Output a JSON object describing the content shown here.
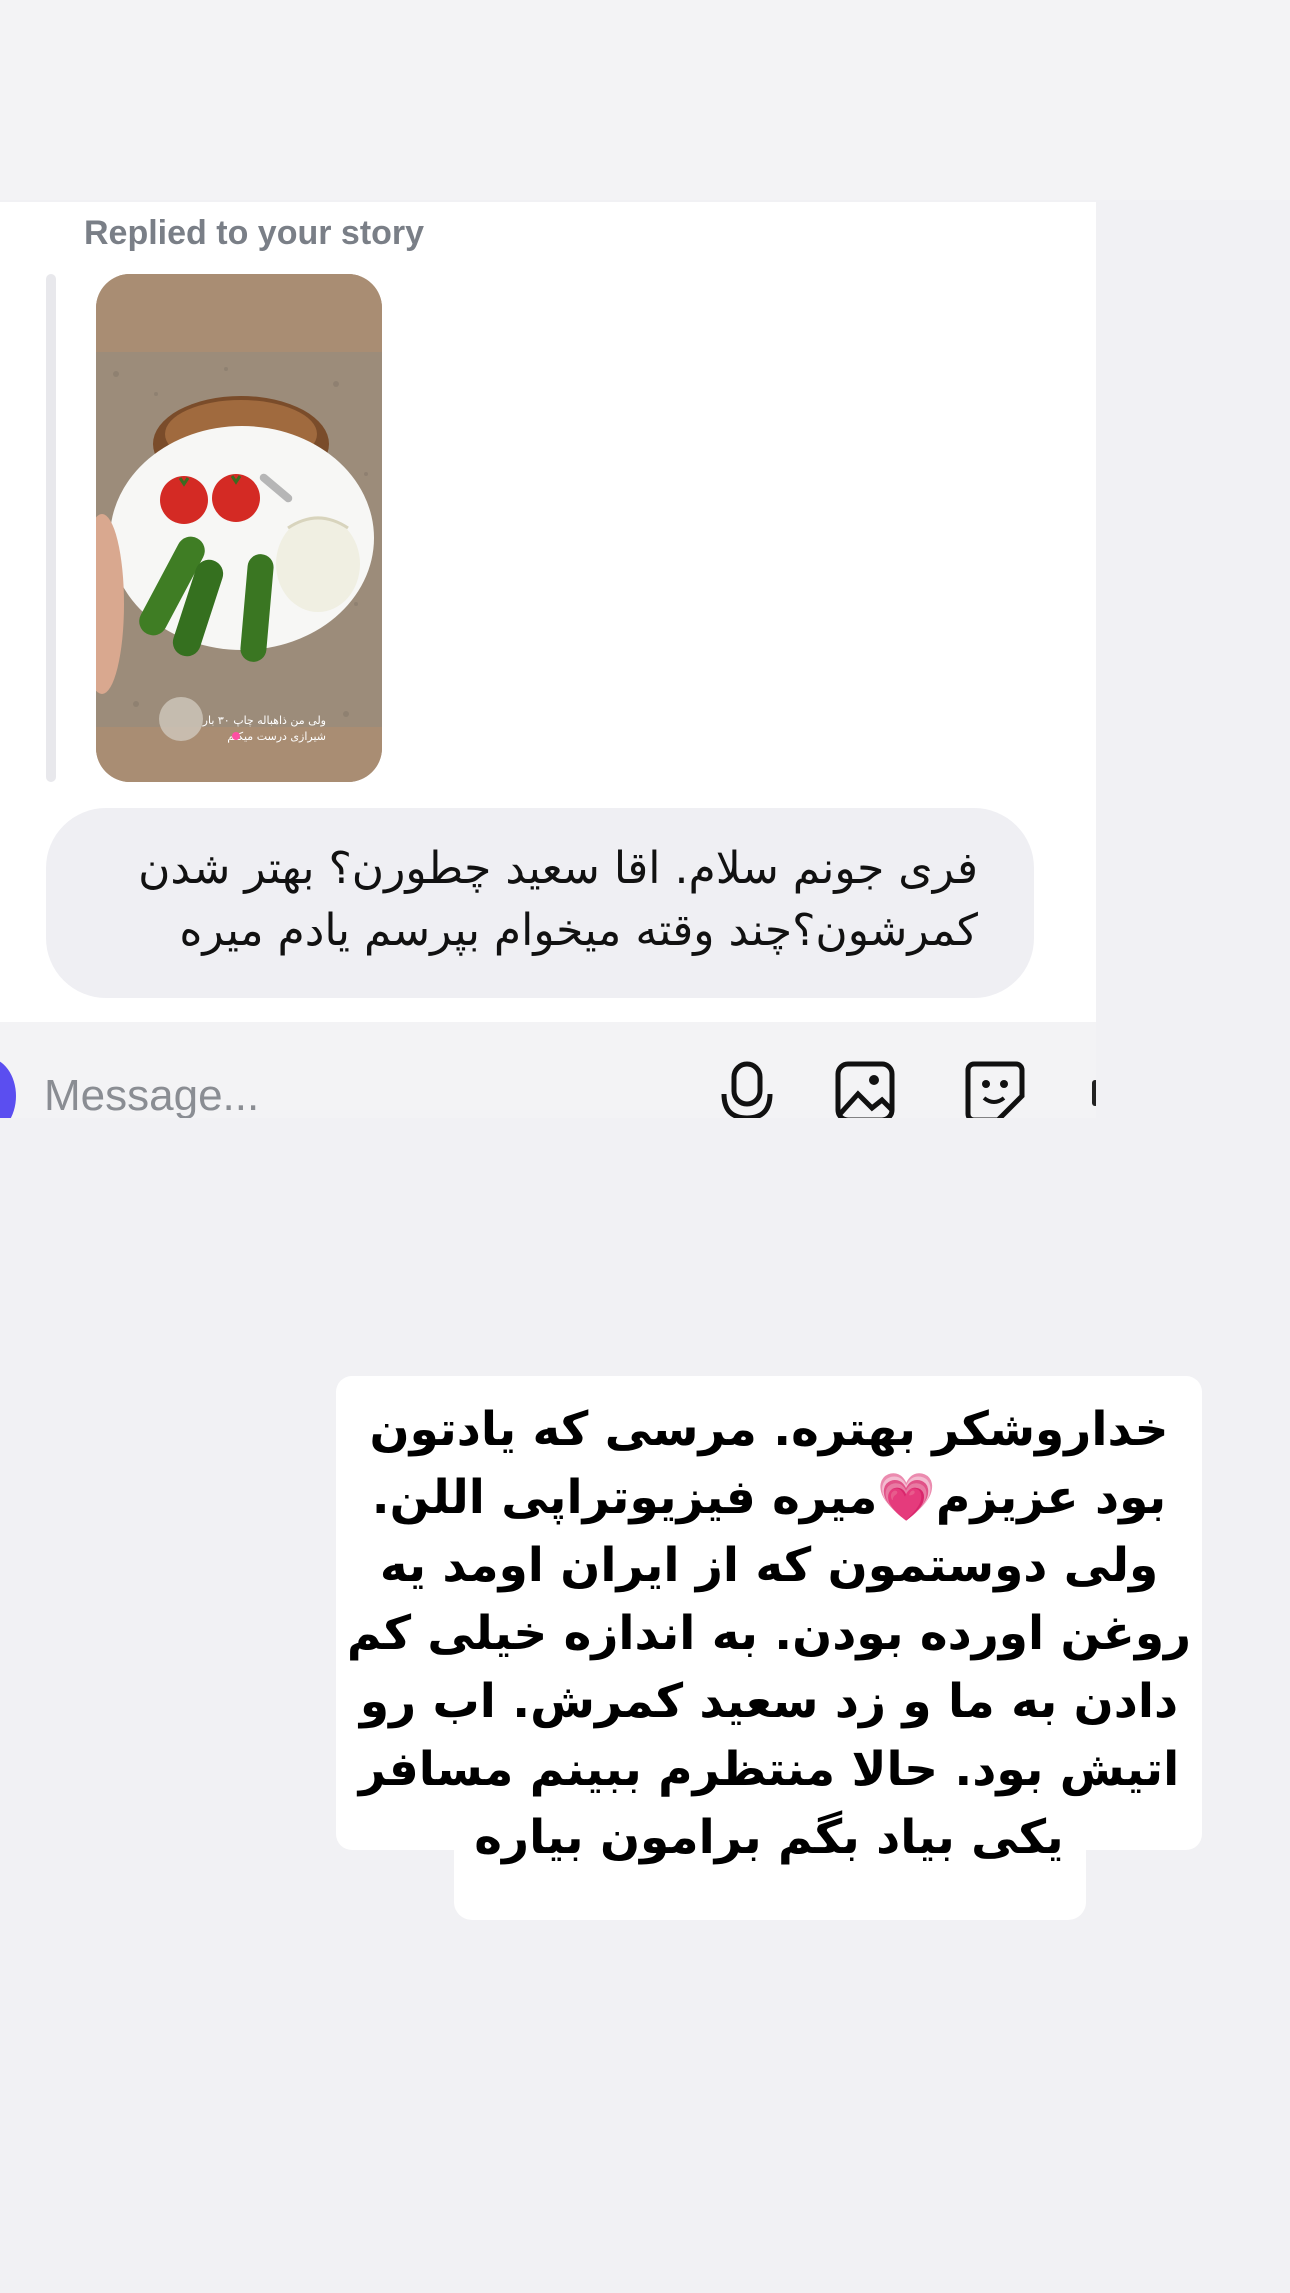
{
  "chat": {
    "replied_label": "Replied to your story",
    "story_overlay_text": "ولی من ذاهباله چاپ ۳۰ بار",
    "story_overlay_text2": "شیرازی درست میکنم",
    "message": "فری جونم سلام. اقا سعید چطورن؟ بهتر شدن کمرشون؟چند وقته میخوام بپرسم یادم میره"
  },
  "composer": {
    "placeholder": "Message...",
    "icons": [
      "camera-icon",
      "microphone-icon",
      "gallery-icon",
      "sticker-icon"
    ],
    "accent": "#5b4ef0"
  },
  "story_caption": {
    "text": "خداروشکر بهتره. مرسی که یادتون\nبود عزیزم💗میره فیزیوتراپی اللن.\nولی دوستمون که از ایران اومد یه\nروغن اورده بودن. به اندازه خیلی کم\nدادن به ما و زد سعید کمرش. اب رو\nاتیش بود. حالا منتظرم ببینم مسافر\nیکی بیاد بگم برامون بیاره"
  }
}
